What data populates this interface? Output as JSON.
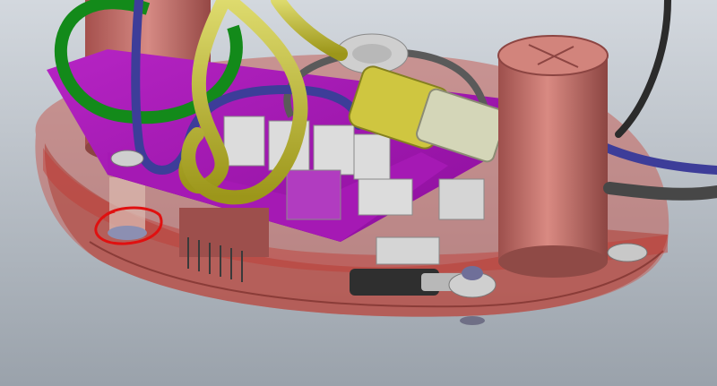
{
  "viewport": {
    "scene": "cad-3d-render",
    "colors": {
      "background_top": "#cfd5db",
      "background_bottom": "#9fa7b0",
      "base_plate": "#b86a66",
      "base_plate_translucent": "#c24a44",
      "pcb_magenta": "#a815b8",
      "capacitor": "#c8736c",
      "cable_blue": "#3d3d99",
      "cable_yellow": "#c9c226",
      "cable_green": "#138a1a",
      "cable_grey": "#5a5a5a",
      "cable_black": "#2b2b2b",
      "connector_white": "#d9d9d9",
      "highlight_circle": "#e01010"
    },
    "annotation": {
      "shape": "hand-drawn-circle",
      "color": "#e01010",
      "target": "standoff-screw"
    }
  }
}
